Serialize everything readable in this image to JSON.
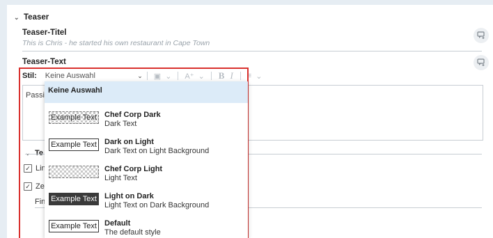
{
  "teaser": {
    "section_label": "Teaser",
    "title_label": "Teaser-Titel",
    "title_placeholder": "This is Chris - he started his own restaurant in Cape Town",
    "text_label": "Teaser-Text"
  },
  "toolbar": {
    "style_label": "Stil:",
    "style_value": "Keine Auswahl",
    "bold": "B",
    "italic": "I"
  },
  "editor": {
    "visible_text": "Passi"
  },
  "fragments": {
    "subsection_label": "Te",
    "checkbox1_label": "Lin",
    "checkbox2_label": "Zei",
    "text3": "Fin"
  },
  "dropdown": {
    "header": "Keine Auswahl",
    "items": [
      {
        "swatch": "Example Text",
        "name": "Chef Corp Dark",
        "desc": "Dark Text",
        "swatch_style": "checker"
      },
      {
        "swatch": "Example Text",
        "name": "Dark on Light",
        "desc": "Dark Text on Light Background",
        "swatch_style": "plain"
      },
      {
        "swatch": "",
        "name": "Chef Corp Light",
        "desc": "Light Text",
        "swatch_style": "checker"
      },
      {
        "swatch": "Example Text",
        "name": "Light on Dark",
        "desc": "Light Text on Dark Background",
        "swatch_style": "dark"
      },
      {
        "swatch": "Example Text",
        "name": "Default",
        "desc": "The default style",
        "swatch_style": "plain"
      }
    ]
  },
  "icons": {
    "collapse": "chevron-down-icon",
    "comment": "comment-add-icon",
    "checkbox": "checkbox-checked-icon"
  },
  "colors": {
    "highlight_frame": "#d9302d",
    "dropdown_header_bg": "#dcebf8",
    "page_bg": "#e6edf3"
  }
}
